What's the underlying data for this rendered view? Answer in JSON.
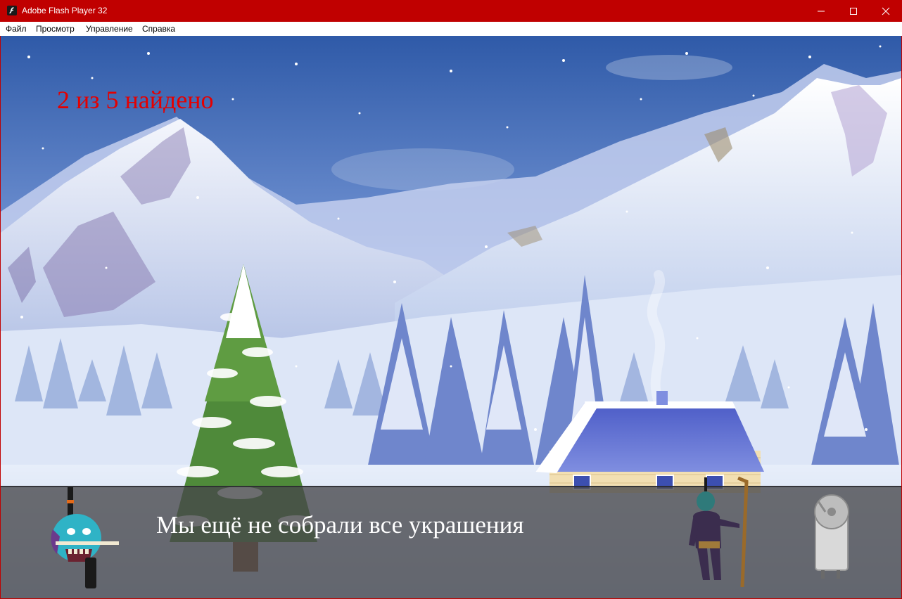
{
  "window": {
    "title": "Adobe Flash Player 32",
    "controls": [
      "minimize",
      "maximize",
      "close"
    ]
  },
  "menu": {
    "items": [
      "Файл",
      "Просмотр",
      "Управление",
      "Справка"
    ]
  },
  "game": {
    "found_counter": "2 из 5 найдено",
    "found": 2,
    "total": 5,
    "dialog_text": "Мы ещё не собрали все украшения"
  },
  "colors": {
    "titlebar": "#c00000",
    "counter_text": "#e40000",
    "dialog_text": "#ffffff"
  },
  "icons": {
    "app": "flash-icon",
    "minimize": "minimize-icon",
    "maximize": "maximize-icon",
    "close": "close-icon"
  }
}
